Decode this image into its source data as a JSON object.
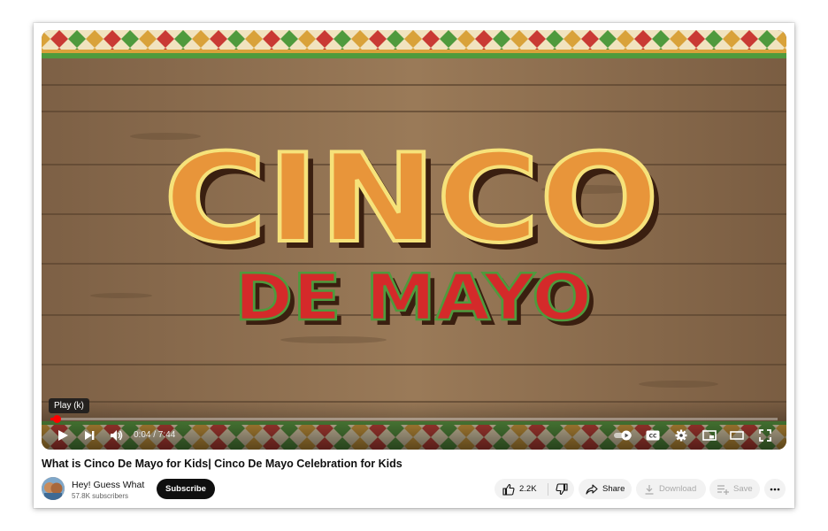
{
  "player": {
    "artwork_line1": "CINCO",
    "artwork_line2": "DE MAYO",
    "tooltip": "Play (k)",
    "time_display": "0:04 / 7:44",
    "progress_fraction": 0.009
  },
  "video": {
    "title": "What is Cinco De Mayo for Kids| Cinco De Mayo Celebration for Kids"
  },
  "channel": {
    "name": "Hey! Guess What",
    "subscribers": "57.8K subscribers",
    "subscribe_label": "Subscribe"
  },
  "actions": {
    "like_count": "2.2K",
    "share_label": "Share",
    "download_label": "Download",
    "save_label": "Save"
  },
  "icons": {
    "play": "play-icon",
    "next": "next-icon",
    "volume": "volume-icon",
    "autoplay": "autoplay-toggle-icon",
    "captions": "cc-icon",
    "settings": "gear-icon",
    "miniplayer": "miniplayer-icon",
    "theater": "theater-icon",
    "fullscreen": "fullscreen-icon",
    "like": "thumbs-up-icon",
    "dislike": "thumbs-down-icon",
    "share": "share-icon",
    "download": "download-icon",
    "save": "playlist-add-icon",
    "more": "more-icon"
  },
  "colors": {
    "progress": "#ff0000",
    "subscribe_bg": "#0f0f0f",
    "pill_bg": "#f2f2f2",
    "letters_orange": "#e8953a",
    "letters_red": "#d42a2a"
  }
}
